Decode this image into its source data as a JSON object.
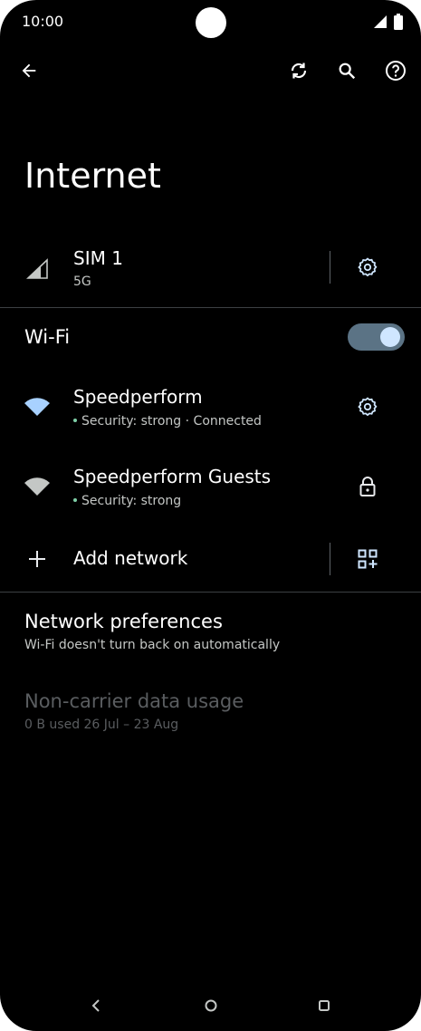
{
  "status_bar": {
    "time": "10:00"
  },
  "page": {
    "title": "Internet"
  },
  "sim": {
    "name": "SIM 1",
    "network": "5G"
  },
  "wifi": {
    "label": "Wi-Fi",
    "enabled": true,
    "networks": [
      {
        "name": "Speedperform",
        "status": "Security: strong · Connected",
        "trailing": "gear-icon"
      },
      {
        "name": "Speedperform Guests",
        "status": "Security: strong",
        "trailing": "lock-icon"
      }
    ],
    "add_network_label": "Add network"
  },
  "preferences": {
    "title": "Network preferences",
    "subtitle": "Wi-Fi doesn't turn back on automatically"
  },
  "data_usage": {
    "title": "Non-carrier data usage",
    "subtitle": "0 B used 26 Jul – 23 Aug"
  },
  "colors": {
    "background": "#000000",
    "toggle_track": "#5b7385",
    "toggle_knob": "#cfe6ff",
    "accent_dot": "#7fd0a8",
    "disabled_text": "#5a5d60"
  }
}
